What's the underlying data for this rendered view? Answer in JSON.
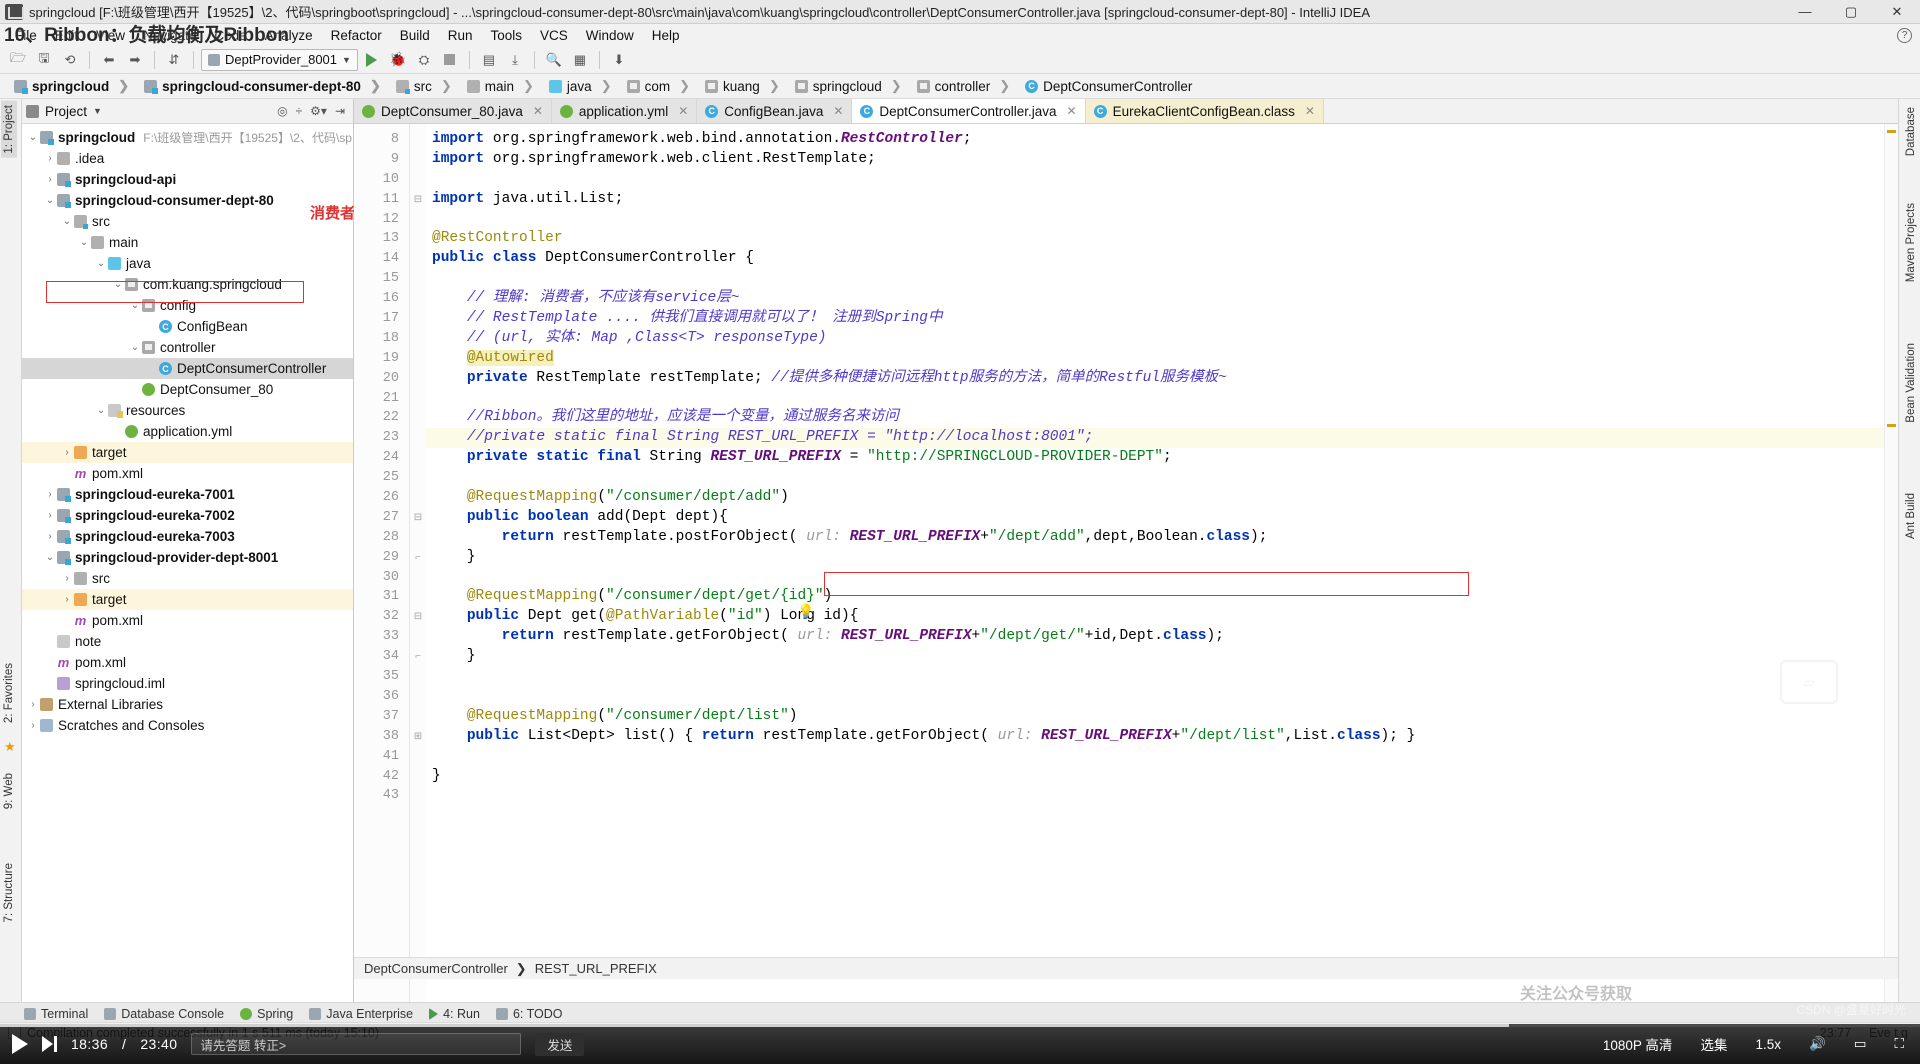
{
  "window": {
    "title": "springcloud [F:\\班级管理\\西开【19525】\\2、代码\\springboot\\springcloud] - ...\\springcloud-consumer-dept-80\\src\\main\\java\\com\\kuang\\springcloud\\controller\\DeptConsumerController.java [springcloud-consumer-dept-80] - IntelliJ IDEA",
    "minimize": "—",
    "maximize": "▢",
    "close": "✕",
    "app_icon": "intellij-idea-icon"
  },
  "overlay": {
    "lesson_title": "10、Ribbon：负载均衡及Ribbon"
  },
  "menubar": {
    "items": [
      "File",
      "Edit",
      "View",
      "Navigate",
      "Code",
      "Analyze",
      "Refactor",
      "Build",
      "Run",
      "Tools",
      "VCS",
      "Window",
      "Help"
    ],
    "help_search": "?"
  },
  "toolbar": {
    "run_config": "DeptProvider_8001",
    "icons": [
      "open-folder-icon",
      "save-all-icon",
      "sync-icon",
      "back-icon",
      "forward-icon",
      "sort-icon",
      "run-icon",
      "debug-icon",
      "coverage-icon",
      "stop-icon",
      "profile-icon",
      "attach-icon",
      "search-everywhere-icon",
      "structure-icon",
      "update-project-icon"
    ]
  },
  "breadcrumb": [
    {
      "label": "springcloud",
      "icon": "module-icon",
      "bold": true
    },
    {
      "label": "springcloud-consumer-dept-80",
      "icon": "module-icon",
      "bold": true
    },
    {
      "label": "src",
      "icon": "source-folder-icon",
      "bold": false
    },
    {
      "label": "main",
      "icon": "folder-icon",
      "bold": false
    },
    {
      "label": "java",
      "icon": "java-source-folder-icon",
      "bold": false
    },
    {
      "label": "com",
      "icon": "package-icon",
      "bold": false
    },
    {
      "label": "kuang",
      "icon": "package-icon",
      "bold": false
    },
    {
      "label": "springcloud",
      "icon": "package-icon",
      "bold": false
    },
    {
      "label": "controller",
      "icon": "package-icon",
      "bold": false
    },
    {
      "label": "DeptConsumerController",
      "icon": "class-icon",
      "bold": false
    }
  ],
  "left_strip": {
    "tabs": [
      "1: Project",
      "2: Favorites",
      "7: Structure"
    ],
    "web_label": "9: Web"
  },
  "right_strip": {
    "tabs": [
      "Database",
      "Maven Projects",
      "Bean Validation",
      "Ant Build"
    ]
  },
  "project_panel": {
    "title": "Project",
    "header_icons": [
      "target-icon",
      "collapse-all-icon",
      "settings-icon",
      "hide-icon"
    ],
    "tree": [
      {
        "depth": 0,
        "arrow": "v",
        "icon": "module-icon",
        "label": "springcloud",
        "bold": true,
        "path": "F:\\班级管理\\西开【19525】\\2、代码\\sp"
      },
      {
        "depth": 1,
        "arrow": ">",
        "icon": "folder-icon",
        "label": ".idea",
        "bold": false
      },
      {
        "depth": 1,
        "arrow": ">",
        "icon": "module-icon",
        "label": "springcloud-api",
        "bold": true
      },
      {
        "depth": 1,
        "arrow": "v",
        "icon": "module-icon",
        "label": "springcloud-consumer-dept-80",
        "bold": true,
        "boxed": true
      },
      {
        "depth": 2,
        "arrow": "v",
        "icon": "source-folder-icon",
        "label": "src",
        "bold": false
      },
      {
        "depth": 3,
        "arrow": "v",
        "icon": "folder-icon",
        "label": "main",
        "bold": false
      },
      {
        "depth": 4,
        "arrow": "v",
        "icon": "java-source-folder-icon",
        "label": "java",
        "bold": false
      },
      {
        "depth": 5,
        "arrow": "v",
        "icon": "package-icon",
        "label": "com.kuang.springcloud",
        "bold": false
      },
      {
        "depth": 6,
        "arrow": "v",
        "icon": "package-icon",
        "label": "config",
        "bold": false
      },
      {
        "depth": 7,
        "arrow": "",
        "icon": "class-icon",
        "label": "ConfigBean",
        "bold": false
      },
      {
        "depth": 6,
        "arrow": "v",
        "icon": "package-icon",
        "label": "controller",
        "bold": false
      },
      {
        "depth": 7,
        "arrow": "",
        "icon": "class-icon",
        "label": "DeptConsumerController",
        "bold": false,
        "selected": true
      },
      {
        "depth": 6,
        "arrow": "",
        "icon": "spring-class-icon",
        "label": "DeptConsumer_80",
        "bold": false
      },
      {
        "depth": 4,
        "arrow": "v",
        "icon": "resources-folder-icon",
        "label": "resources",
        "bold": false
      },
      {
        "depth": 5,
        "arrow": "",
        "icon": "spring-yaml-icon",
        "label": "application.yml",
        "bold": false
      },
      {
        "depth": 2,
        "arrow": ">",
        "icon": "excluded-folder-icon",
        "label": "target",
        "bold": false,
        "highlight": true
      },
      {
        "depth": 2,
        "arrow": "",
        "icon": "maven-icon",
        "label": "pom.xml",
        "bold": false
      },
      {
        "depth": 1,
        "arrow": ">",
        "icon": "module-icon",
        "label": "springcloud-eureka-7001",
        "bold": true
      },
      {
        "depth": 1,
        "arrow": ">",
        "icon": "module-icon",
        "label": "springcloud-eureka-7002",
        "bold": true
      },
      {
        "depth": 1,
        "arrow": ">",
        "icon": "module-icon",
        "label": "springcloud-eureka-7003",
        "bold": true
      },
      {
        "depth": 1,
        "arrow": "v",
        "icon": "module-icon",
        "label": "springcloud-provider-dept-8001",
        "bold": true
      },
      {
        "depth": 2,
        "arrow": ">",
        "icon": "folder-icon",
        "label": "src",
        "bold": false
      },
      {
        "depth": 2,
        "arrow": ">",
        "icon": "excluded-folder-icon",
        "label": "target",
        "bold": false,
        "highlight": true
      },
      {
        "depth": 2,
        "arrow": "",
        "icon": "maven-icon",
        "label": "pom.xml",
        "bold": false
      },
      {
        "depth": 1,
        "arrow": "",
        "icon": "file-icon",
        "label": "note",
        "bold": false
      },
      {
        "depth": 1,
        "arrow": "",
        "icon": "maven-icon",
        "label": "pom.xml",
        "bold": false
      },
      {
        "depth": 1,
        "arrow": "",
        "icon": "iml-icon",
        "label": "springcloud.iml",
        "bold": false
      },
      {
        "depth": 0,
        "arrow": ">",
        "icon": "library-icon",
        "label": "External Libraries",
        "bold": false
      },
      {
        "depth": 0,
        "arrow": ">",
        "icon": "scratch-icon",
        "label": "Scratches and Consoles",
        "bold": false
      }
    ],
    "annotation_consumer": "消费者"
  },
  "editor": {
    "tabs": [
      {
        "label": "DeptConsumer_80.java",
        "icon": "spring-class-icon",
        "state": "normal"
      },
      {
        "label": "application.yml",
        "icon": "spring-yaml-icon",
        "state": "normal"
      },
      {
        "label": "ConfigBean.java",
        "icon": "class-icon",
        "state": "normal"
      },
      {
        "label": "DeptConsumerController.java",
        "icon": "class-icon",
        "state": "active"
      },
      {
        "label": "EurekaClientConfigBean.class",
        "icon": "class-icon",
        "state": "readonly"
      }
    ],
    "first_line_number": 8,
    "lines": [
      {
        "n": 8,
        "html": "<span class=\"kw\">import</span> org.springframework.web.bind.annotation.<span class=\"fld\">RestController</span>;"
      },
      {
        "n": 9,
        "html": "<span class=\"kw\">import</span> org.springframework.web.client.RestTemplate;"
      },
      {
        "n": 10,
        "html": ""
      },
      {
        "n": 11,
        "html": "<span class=\"kw\">import</span> java.util.List;",
        "fold": "-"
      },
      {
        "n": 12,
        "html": ""
      },
      {
        "n": 13,
        "html": "<span class=\"ann\">@RestController</span>"
      },
      {
        "n": 14,
        "html": "<span class=\"kw\">public class</span> DeptConsumerController {",
        "gutter_icon": "spring-bean-icon"
      },
      {
        "n": 15,
        "html": ""
      },
      {
        "n": 16,
        "html": "    <span class=\"cmt-i\">// 理解: 消费者，不应该有service层~</span>"
      },
      {
        "n": 17,
        "html": "    <span class=\"cmt-i\">// RestTemplate .... 供我们直接调用就可以了！ 注册到Spring中</span>"
      },
      {
        "n": 18,
        "html": "    <span class=\"cmt-i\">// (url, 实体: Map ,Class&lt;T&gt; responseType)</span>"
      },
      {
        "n": 19,
        "html": "    <span class=\"ann mark\">@Autowired</span>"
      },
      {
        "n": 20,
        "html": "    <span class=\"kw\">private</span> RestTemplate restTemplate; <span class=\"cmt-i\">//提供多种便捷访问远程http服务的方法，简单的Restful服务模板~</span>",
        "gutter_icon": "bean-inject-icon"
      },
      {
        "n": 21,
        "html": ""
      },
      {
        "n": 22,
        "html": "    <span class=\"cmt-i\">//Ribbon。我们这里的地址，应该是一个变量，通过服务名来访问</span>",
        "boxed": true
      },
      {
        "n": 23,
        "html": "    <span class=\"cmt-i\">//private static final String REST_URL_PREFIX = \"http://localhost:8001\";</span>",
        "highlight": true,
        "bulb": true,
        "caret": true
      },
      {
        "n": 24,
        "html": "    <span class=\"kw\">private static final</span> String <span class=\"fld\">REST_URL_PREFIX</span> = <span class=\"str\">\"http://SPRINGCLOUD-PROVIDER-DEPT\"</span>;"
      },
      {
        "n": 25,
        "html": ""
      },
      {
        "n": 26,
        "html": "    <span class=\"ann\">@RequestMapping</span>(<span class=\"str\">\"/consumer/dept/add\"</span>)"
      },
      {
        "n": 27,
        "html": "    <span class=\"kw\">public boolean</span> add(Dept dept){",
        "fold": "-"
      },
      {
        "n": 28,
        "html": "        <span class=\"kw\">return</span> restTemplate.postForObject( <span class=\"hint\">url:</span> <span class=\"fld\">REST_URL_PREFIX</span>+<span class=\"str\">\"/dept/add\"</span>,dept,Boolean.<span class=\"kw\">class</span>);"
      },
      {
        "n": 29,
        "html": "    }",
        "fold": "a"
      },
      {
        "n": 30,
        "html": ""
      },
      {
        "n": 31,
        "html": "    <span class=\"ann\">@RequestMapping</span>(<span class=\"str\">\"/consumer/dept/get/{id}\"</span>)"
      },
      {
        "n": 32,
        "html": "    <span class=\"kw\">public</span> Dept get(<span class=\"ann\">@PathVariable</span>(<span class=\"str\">\"id\"</span>) Long id){",
        "fold": "-"
      },
      {
        "n": 33,
        "html": "        <span class=\"kw\">return</span> restTemplate.getForObject( <span class=\"hint\">url:</span> <span class=\"fld\">REST_URL_PREFIX</span>+<span class=\"str\">\"/dept/get/\"</span>+id,Dept.<span class=\"kw\">class</span>);"
      },
      {
        "n": 34,
        "html": "    }",
        "fold": "a"
      },
      {
        "n": 35,
        "html": ""
      },
      {
        "n": 36,
        "html": ""
      },
      {
        "n": 37,
        "html": "    <span class=\"ann\">@RequestMapping</span>(<span class=\"str\">\"/consumer/dept/list\"</span>)"
      },
      {
        "n": 38,
        "html": "    <span class=\"kw\">public</span> List&lt;Dept&gt; list() { <span class=\"kw\">return</span> restTemplate.getForObject( <span class=\"hint\">url:</span> <span class=\"fld\">REST_URL_PREFIX</span>+<span class=\"str\">\"/dept/list\"</span>,List.<span class=\"kw\">class</span>); }",
        "fold": "+"
      },
      {
        "n": 41,
        "html": ""
      },
      {
        "n": 42,
        "html": "}"
      },
      {
        "n": 43,
        "html": ""
      }
    ],
    "bottom_breadcrumb": [
      "DeptConsumerController",
      "REST_URL_PREFIX"
    ]
  },
  "bottom_tool_bar": {
    "items": [
      {
        "label": "Terminal",
        "icon": "terminal-icon"
      },
      {
        "label": "Database Console",
        "icon": "database-icon"
      },
      {
        "label": "Spring",
        "icon": "spring-icon"
      },
      {
        "label": "Java Enterprise",
        "icon": "java-ee-icon"
      },
      {
        "label": "4: Run",
        "icon": "run-icon"
      },
      {
        "label": "6: TODO",
        "icon": "todo-icon"
      }
    ]
  },
  "statusbar": {
    "message": "Compilation completed successfully in 1 s 511 ms (today 15:10)",
    "icon": "build-icon",
    "time": "23:77",
    "encoding": "Eve t  g"
  },
  "video_player": {
    "current_time": "18:36",
    "total_time": "23:40",
    "separator": "/",
    "danmaku_placeholder": "请先答题 转正>",
    "send_label": "发送",
    "quality": "1080P 高清",
    "episodes": "选集",
    "speed": "1.5x",
    "progress_percent": 78.6,
    "watermark": "CSDN @盛夏好时光",
    "watermark_left": "关注公众号获取",
    "icons": [
      "play-icon",
      "next-icon",
      "volume-icon",
      "fullscreen-icon",
      "settings-icon",
      "webfull-icon",
      "danmaku-icon"
    ]
  }
}
